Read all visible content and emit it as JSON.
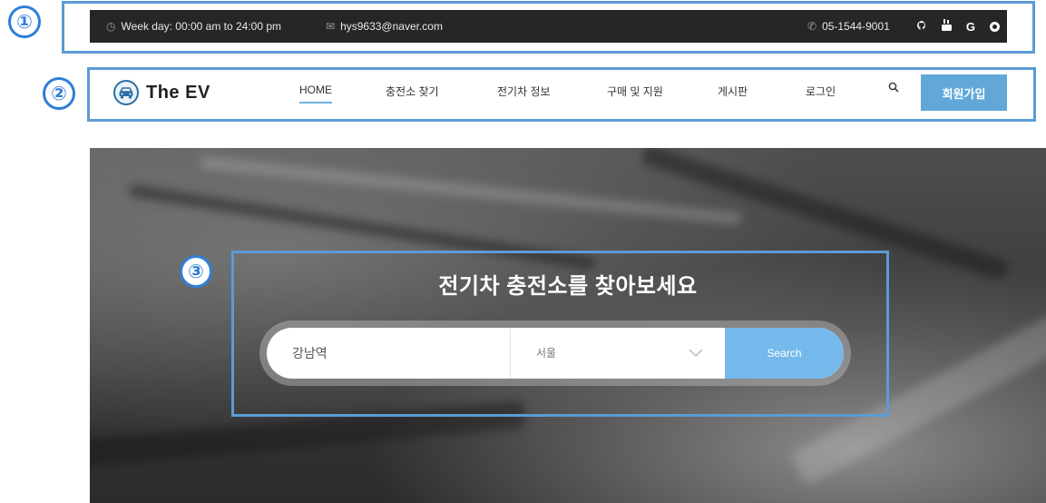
{
  "annotations": {
    "marker_1": "①",
    "marker_2": "②",
    "marker_3": "③"
  },
  "topbar": {
    "hours_icon": "clock-icon",
    "hours": "Week day: 00:00 am to 24:00 pm",
    "email_icon": "envelope-icon",
    "email": "hys9633@naver.com",
    "phone_icon": "phone-icon",
    "phone": "05-1544-9001",
    "social": [
      "github-icon",
      "youtube-icon",
      "google-icon",
      "other-social-icon"
    ],
    "google_glyph": "G"
  },
  "navbar": {
    "logo_icon": "car-icon",
    "logo_text": "The EV",
    "items": [
      {
        "label": "HOME",
        "active": true
      },
      {
        "label": "충전소 찾기"
      },
      {
        "label": "전기차 정보"
      },
      {
        "label": "구매 및 지원"
      },
      {
        "label": "게시판"
      },
      {
        "label": "로그인"
      }
    ],
    "search_icon": "search-icon",
    "signup_label": "회원가입",
    "accent_color": "#61a8d9"
  },
  "hero": {
    "title": "전기차 충전소를 찾아보세요",
    "search": {
      "input_value": "강남역",
      "region_value": "서울",
      "button_label": "Search",
      "button_color": "#76b9ec"
    }
  }
}
